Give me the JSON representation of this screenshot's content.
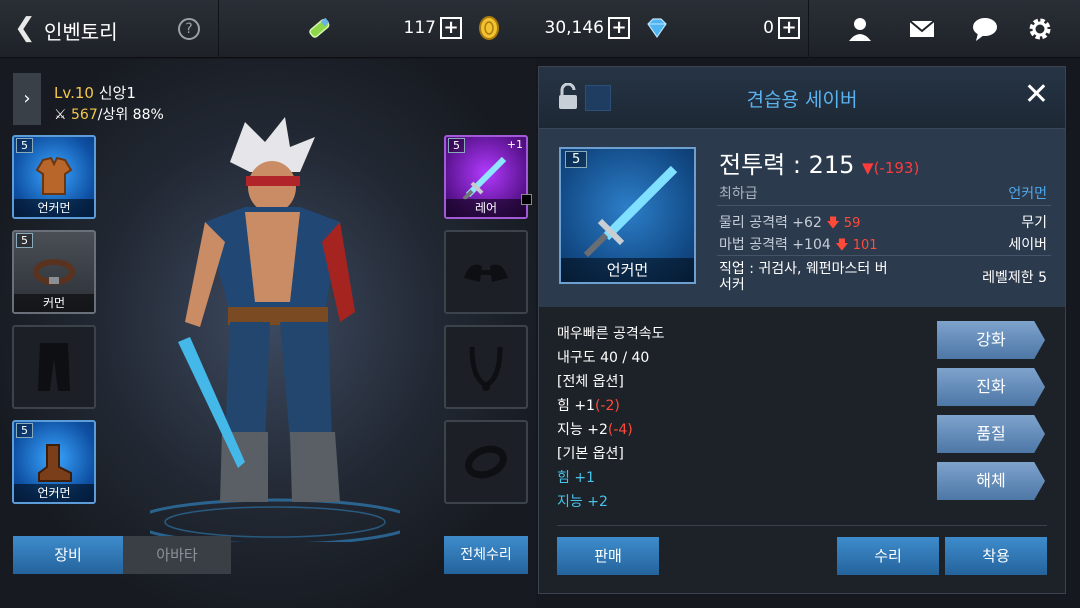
{
  "header": {
    "title": "인벤토리",
    "help": "?",
    "stamina": "117",
    "gold": "30,146",
    "gems": "0",
    "plus": "+"
  },
  "character": {
    "level": "Lv.10",
    "name": "신앙1",
    "power": "567",
    "rank": "/상위 88%"
  },
  "left_slots": [
    {
      "num": "5",
      "label": "언커먼"
    },
    {
      "num": "5",
      "label": "커먼"
    },
    {
      "num": "",
      "label": ""
    },
    {
      "num": "5",
      "label": "언커먼"
    }
  ],
  "right_slots": [
    {
      "num": "5",
      "label": "레어",
      "enh": "+1"
    }
  ],
  "tabs": {
    "equip": "장비",
    "avatar": "아바타"
  },
  "repair_all": "전체수리",
  "item": {
    "title": "견습용 세이버",
    "slot_num": "5",
    "slot_label": "언커먼",
    "cp_label": "전투력 : 215",
    "cp_diff": "▼(-193)",
    "grade": "최하급",
    "rarity": "언커먼",
    "phys": "물리 공격력 +62",
    "phys_diff": "🡇 59",
    "magic": "마법 공격력 +104",
    "magic_diff": "🡇 101",
    "type1": "무기",
    "type2": "세이버",
    "job": "직업 : 귀검사, 웨펀마스터 버서커",
    "req": "레벨제한 5",
    "desc": [
      {
        "text": "매우빠른 공격속도",
        "cls": ""
      },
      {
        "text": "내구도 40 / 40",
        "cls": ""
      },
      {
        "text": "[전체 옵션]",
        "cls": ""
      },
      {
        "text": "힘 +1",
        "diff": "(-2)",
        "cls": "red"
      },
      {
        "text": "지능 +2",
        "diff": "(-4)",
        "cls": "red"
      },
      {
        "text": "[기본 옵션]",
        "cls": ""
      },
      {
        "text": "힘 +1",
        "cls": "cyan"
      },
      {
        "text": "지능 +2",
        "cls": "cyan"
      }
    ],
    "side_buttons": [
      "강화",
      "진화",
      "품질",
      "해체"
    ],
    "sell": "판매",
    "repair": "수리",
    "equip": "착용"
  }
}
